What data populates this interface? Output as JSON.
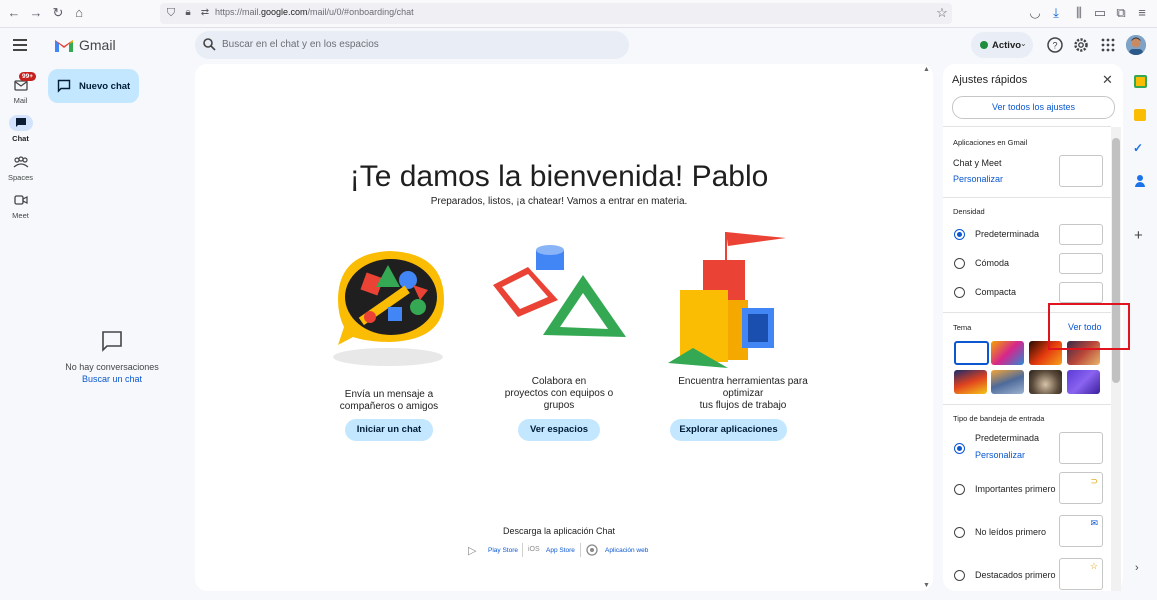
{
  "browser": {
    "url_prefix": "https://mail.",
    "url_domain": "google.com",
    "url_path": "/mail/u/0/#onboarding/chat"
  },
  "header": {
    "app_name": "Gmail",
    "search_placeholder": "Buscar en el chat y en los espacios",
    "status_label": "Activo"
  },
  "rail": {
    "mail_label": "Mail",
    "mail_badge": "99+",
    "chat_label": "Chat",
    "spaces_label": "Spaces",
    "meet_label": "Meet"
  },
  "sidebar": {
    "new_chat": "Nuevo chat",
    "empty_text": "No hay conversaciones",
    "empty_link": "Buscar un chat"
  },
  "main": {
    "title": "¡Te damos la bienvenida! Pablo",
    "subtitle": "Preparados, listos, ¡a chatear! Vamos a entrar en materia.",
    "cards": [
      {
        "line1": "Envía un mensaje a",
        "line2": "compañeros o amigos",
        "line3": "",
        "button": "Iniciar un chat"
      },
      {
        "line1": "Colabora en",
        "line2": "proyectos con equipos o",
        "line3": "grupos",
        "button": "Ver espacios"
      },
      {
        "line1": "Encuentra herramientas para",
        "line2": "optimizar",
        "line3": "tus flujos de trabajo",
        "button": "Explorar aplicaciones"
      }
    ],
    "download_title": "Descarga la aplicación Chat",
    "play_store": "Play Store",
    "ios_label": "iOS",
    "app_store": "App Store",
    "web_app": "Aplicación web"
  },
  "quick_settings": {
    "title": "Ajustes rápidos",
    "see_all": "Ver todos los ajustes",
    "apps_section": "Aplicaciones en Gmail",
    "chat_meet": "Chat y Meet",
    "customize": "Personalizar",
    "density_section": "Densidad",
    "density_options": [
      "Predeterminada",
      "Cómoda",
      "Compacta"
    ],
    "density_selected": "Predeterminada",
    "theme_section": "Tema",
    "theme_see_all": "Ver todo",
    "inbox_section": "Tipo de bandeja de entrada",
    "inbox_options": [
      "Predeterminada",
      "Importantes primero",
      "No leídos primero",
      "Destacados primero"
    ],
    "inbox_selected": "Predeterminada",
    "inbox_customize": "Personalizar"
  },
  "colors": {
    "accent": "#0b57d0",
    "pill": "#c2e7ff",
    "highlight_box": "#e0141e"
  }
}
